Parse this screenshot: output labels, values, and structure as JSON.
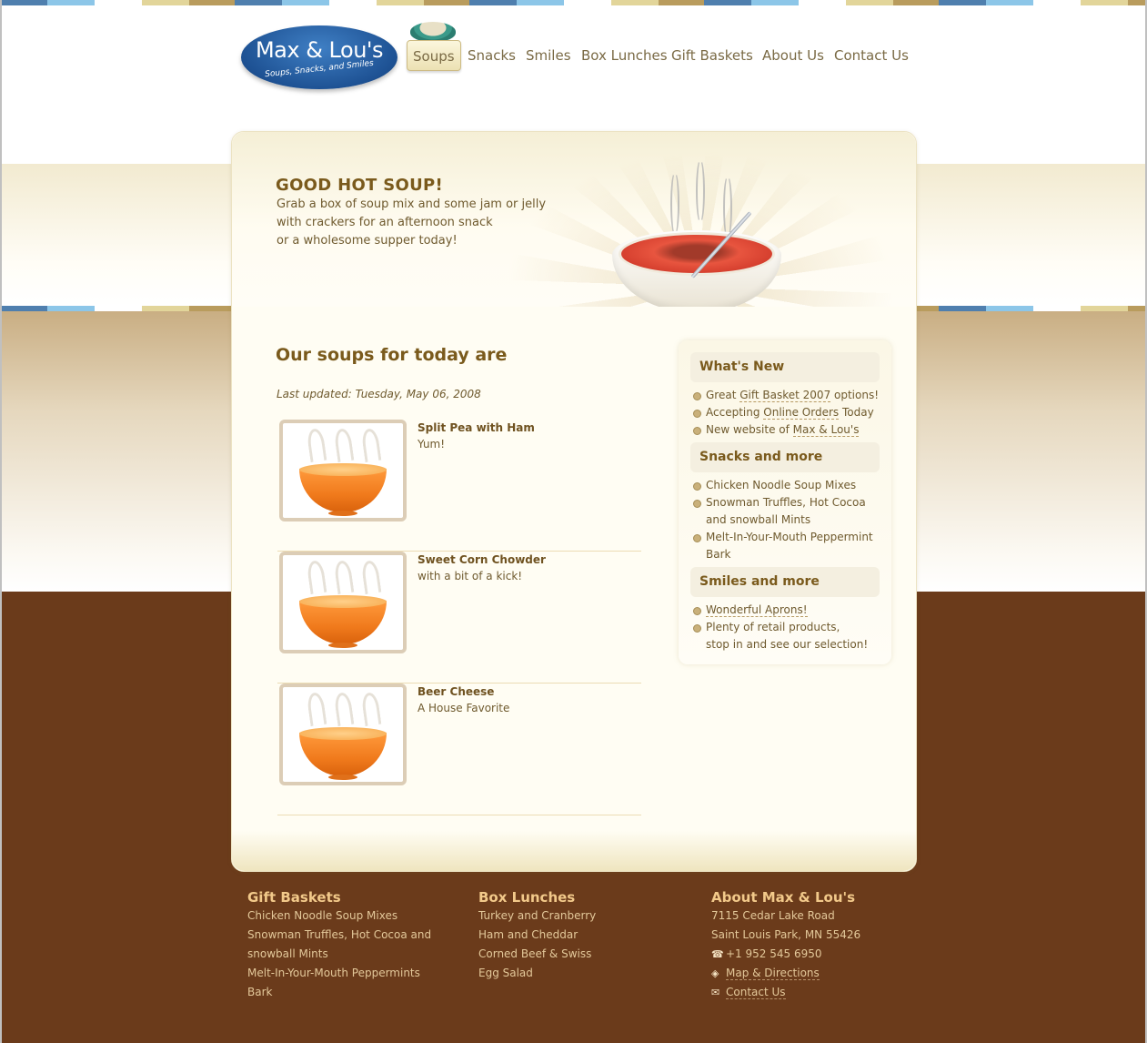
{
  "brand": {
    "name": "Max & Lou's",
    "tagline": "Soups, Snacks, and Smiles"
  },
  "nav": {
    "items": [
      {
        "label": "Soups",
        "active": true
      },
      {
        "label": "Snacks"
      },
      {
        "label": "Smiles"
      },
      {
        "label": "Box Lunches"
      },
      {
        "label": "Gift Baskets"
      },
      {
        "label": "About Us"
      },
      {
        "label": "Contact Us"
      }
    ]
  },
  "hero": {
    "title": "GOOD HOT SOUP!",
    "lines": [
      "Grab a box of soup mix and some jam or jelly",
      "with crackers for an afternoon snack",
      "or a wholesome supper today!"
    ]
  },
  "main": {
    "title": "Our soups for today are",
    "updated": "Last updated: Tuesday, May 06, 2008",
    "soups": [
      {
        "name": "Split Pea with Ham",
        "desc": "Yum!"
      },
      {
        "name": "Sweet Corn Chowder",
        "desc": "with a bit of a kick!"
      },
      {
        "name": "Beer Cheese",
        "desc": "A House Favorite"
      }
    ]
  },
  "sidebar": {
    "sections": [
      {
        "title": "What's New",
        "items": [
          {
            "pre": "Great ",
            "link": "Gift Basket 2007",
            "post": " options!"
          },
          {
            "pre": "Accepting ",
            "link": "Online Orders",
            "post": " Today"
          },
          {
            "pre": "New website of ",
            "link": "Max & Lou's",
            "post": ""
          }
        ]
      },
      {
        "title": "Snacks and more",
        "items": [
          {
            "lines": [
              "Chicken Noodle Soup Mixes"
            ]
          },
          {
            "lines": [
              "Snowman Truffles, Hot Cocoa",
              "and snowball Mints"
            ]
          },
          {
            "lines": [
              "Melt-In-Your-Mouth Peppermint",
              "Bark"
            ]
          }
        ]
      },
      {
        "title": "Smiles and more",
        "items": [
          {
            "link": "Wonderful Aprons!"
          },
          {
            "lines": [
              "Plenty of retail products,",
              "stop in and see our selection!"
            ]
          }
        ]
      }
    ]
  },
  "footer": {
    "gift_baskets": {
      "title": "Gift Baskets",
      "lines": [
        "Chicken Noodle Soup Mixes",
        "Snowman Truffles, Hot Cocoa and",
        "snowball Mints",
        "Melt-In-Your-Mouth Peppermints",
        "Bark"
      ]
    },
    "box_lunches": {
      "title": "Box Lunches",
      "lines": [
        "Turkey and Cranberry",
        "Ham and Cheddar",
        "Corned Beef & Swiss",
        "Egg Salad"
      ]
    },
    "about": {
      "title": "About Max & Lou's",
      "address1": "7115 Cedar Lake Road",
      "address2": "Saint Louis Park, MN 55426",
      "phone": "+1 952 545 6950",
      "map_link": "Map & Directions",
      "contact_link": "Contact Us"
    }
  },
  "colors": {
    "brown": "#6b3b1b",
    "cream": "#fffdf3",
    "heading": "#7a5a1c",
    "logo_blue": "#1e5294"
  },
  "icons": {
    "phone": "phone-icon",
    "map": "map-pin-icon",
    "mail": "mail-icon"
  }
}
